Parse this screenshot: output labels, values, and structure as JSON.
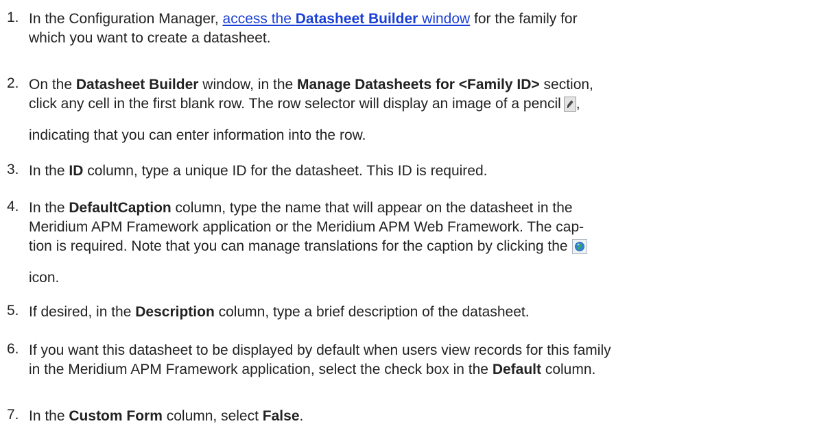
{
  "steps": [
    {
      "number": "1.",
      "line1_link_pre": "access the ",
      "line1_link_kw": "Datasheet Builder",
      "line1_link_post": " window",
      "line1_pre": "In the Configuration Manager, ",
      "line1_post": " for the family for",
      "line2": "which you want to create a datasheet."
    },
    {
      "number": "2.",
      "line1_pre": "On the ",
      "line1_kw1": "Datasheet Builder",
      "line1_mid": " window, in the ",
      "line1_kw2": "Manage Datasheets for <Family ID>",
      "line1_post": " section,",
      "line2_pre": "click any cell in the first blank row. The row selector will display an image of a pencil",
      "line2_post": ",",
      "pencil_icon": "pencil-icon",
      "line3": "indicating that you can enter information into the row."
    },
    {
      "number": "3.",
      "pre": "In the ",
      "kw": "ID",
      "post": " column, type a unique ID for the datasheet. This ID is required."
    },
    {
      "number": "4.",
      "line1_pre": "In the ",
      "line1_kw": "DefaultCaption",
      "line1_post": " column, type the name that will appear on the datasheet in the",
      "line2": "Meridium APM Framework application or the Meridium APM Web Framework. The cap-",
      "line3": "tion is required. Note that you can manage translations for the caption by clicking the",
      "globe_icon": "globe-icon",
      "line4": "icon."
    },
    {
      "number": "5.",
      "pre": "If desired, in the ",
      "kw": "Description",
      "post": " column, type a brief description of the datasheet."
    },
    {
      "number": "6.",
      "line1": "If you want this datasheet to be displayed by default when users view records for this family",
      "line2_pre": "in the Meridium APM Framework application, select the check box in the ",
      "line2_kw": "Default",
      "line2_post": " column."
    },
    {
      "number": "7.",
      "pre": "In the ",
      "kw1": "Custom Form",
      "mid": " column, select ",
      "kw2": "False",
      "post": "."
    }
  ],
  "colors": {
    "link": "#1a3fd6",
    "text": "#222222",
    "background": "#ffffff"
  }
}
